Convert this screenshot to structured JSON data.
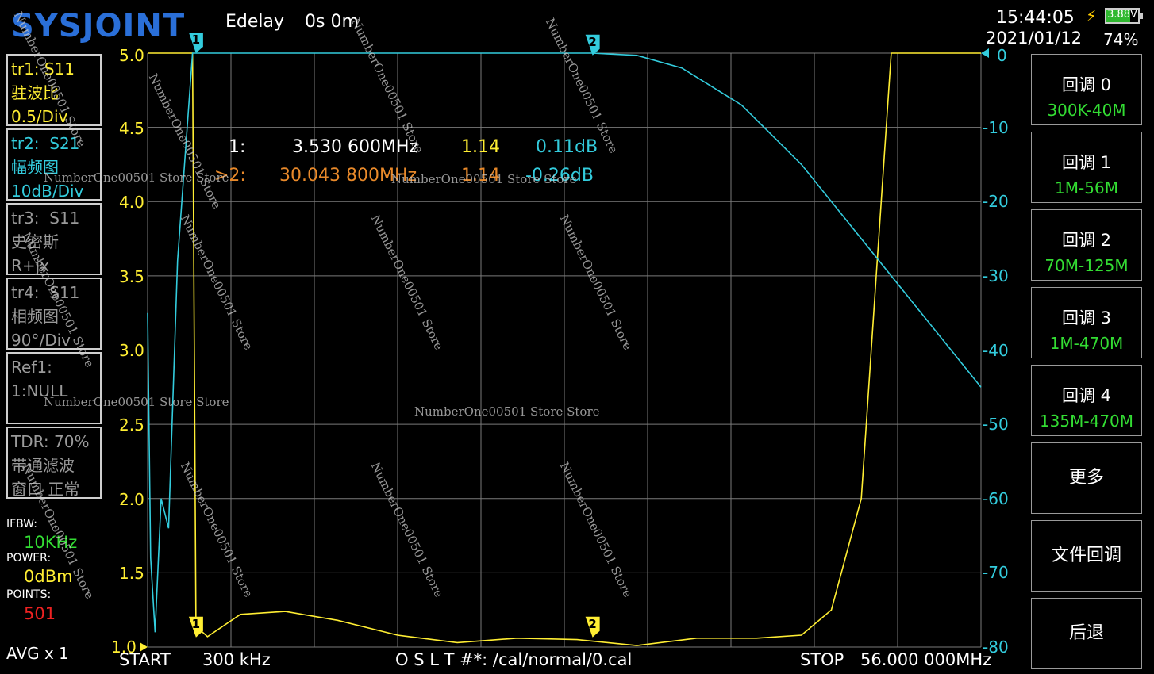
{
  "header": {
    "logo": "SYSJOINT",
    "edelay_label": "Edelay",
    "edelay_value": "0s 0m",
    "time": "15:44:05",
    "date": "2021/01/12",
    "battery_voltage": "3.88V",
    "battery_percent": "74%"
  },
  "traces": [
    {
      "id": "tr1:",
      "param": "S11",
      "format": "驻波比",
      "scale": "0.5/Div",
      "color": "#ffee33"
    },
    {
      "id": "tr2:",
      "param": "S21",
      "format": "幅频图",
      "scale": "10dB/Div",
      "color": "#33ccdd"
    },
    {
      "id": "tr3:",
      "param": "S11",
      "format": "史密斯",
      "scale": "R+jx",
      "color": "#9a9a9a"
    },
    {
      "id": "tr4:",
      "param": "S11",
      "format": "相频图",
      "scale": "90°/Div",
      "color": "#9a9a9a"
    }
  ],
  "ref": {
    "line1": "Ref1:",
    "line2": "1:NULL"
  },
  "tdr": {
    "line1": "TDR: 70%",
    "line2": "带通滤波",
    "line3": "窗口 正常"
  },
  "params": {
    "ifbw_label": "IFBW:",
    "ifbw_value": "10KHz",
    "power_label": "POWER:",
    "power_value": "0dBm",
    "points_label": "POINTS:",
    "points_value": "501",
    "avg": "AVG x 1"
  },
  "axes": {
    "left": [
      "5.0",
      "4.5",
      "4.0",
      "3.5",
      "3.0",
      "2.5",
      "2.0",
      "1.5",
      "1.0"
    ],
    "right": [
      "0",
      "-10",
      "-20",
      "-30",
      "-40",
      "-50",
      "-60",
      "-70",
      "-80"
    ]
  },
  "markers": [
    {
      "prefix": "1:",
      "freq": "3.530 600MHz",
      "vswr": "1.14",
      "db": "0.11dB"
    },
    {
      "prefix": ">2:",
      "freq": "30.043 800MHz",
      "vswr": "1.14",
      "db": "-0.26dB"
    }
  ],
  "marker_flags": [
    "1",
    "2"
  ],
  "side_menu": [
    {
      "title": "回调 0",
      "sub": "300K-40M"
    },
    {
      "title": "回调 1",
      "sub": "1M-56M"
    },
    {
      "title": "回调 2",
      "sub": "70M-125M"
    },
    {
      "title": "回调 3",
      "sub": "1M-470M"
    },
    {
      "title": "回调 4",
      "sub": "135M-470M"
    },
    {
      "title": "更多",
      "sub": ""
    },
    {
      "title": "文件回调",
      "sub": ""
    },
    {
      "title": "后退",
      "sub": ""
    }
  ],
  "footer": {
    "start_label": "START",
    "start_value": "300 kHz",
    "cal": "O S L T #*: /cal/normal/0.cal",
    "stop_label": "STOP",
    "stop_value": "56.000 000MHz"
  },
  "watermark": "NumberOne00501 Store",
  "watermark_long": "NumberOne00501 Store Store",
  "chart_data": {
    "type": "line",
    "x_start_mhz": 0.3,
    "x_stop_mhz": 56.0,
    "left_axis": {
      "ylim": [
        1.0,
        5.0
      ]
    },
    "right_axis": {
      "ylim": [
        -80,
        0
      ]
    },
    "series": [
      {
        "name": "tr1: S11",
        "axis": "left",
        "color": "#ffee33",
        "points": [
          [
            0.3,
            5.0
          ],
          [
            3.3,
            5.0
          ],
          [
            3.53,
            1.14
          ],
          [
            4.3,
            1.07
          ],
          [
            6.5,
            1.22
          ],
          [
            9.5,
            1.24
          ],
          [
            13,
            1.18
          ],
          [
            17,
            1.08
          ],
          [
            21,
            1.03
          ],
          [
            25,
            1.06
          ],
          [
            29,
            1.05
          ],
          [
            33,
            1.01
          ],
          [
            37,
            1.06
          ],
          [
            41,
            1.06
          ],
          [
            44,
            1.08
          ],
          [
            46,
            1.25
          ],
          [
            48,
            2.0
          ],
          [
            49,
            3.5
          ],
          [
            50,
            5.0
          ],
          [
            56,
            5.0
          ]
        ]
      },
      {
        "name": "tr2: S21",
        "axis": "right",
        "color": "#33ccdd",
        "points": [
          [
            0.3,
            -35
          ],
          [
            0.5,
            -68
          ],
          [
            0.8,
            -78
          ],
          [
            1.2,
            -60
          ],
          [
            1.7,
            -64
          ],
          [
            2.3,
            -28
          ],
          [
            3.3,
            0
          ],
          [
            10,
            0
          ],
          [
            30,
            0
          ],
          [
            33,
            -0.3
          ],
          [
            36,
            -2
          ],
          [
            40,
            -7
          ],
          [
            44,
            -15
          ],
          [
            56,
            -45
          ]
        ]
      }
    ]
  }
}
